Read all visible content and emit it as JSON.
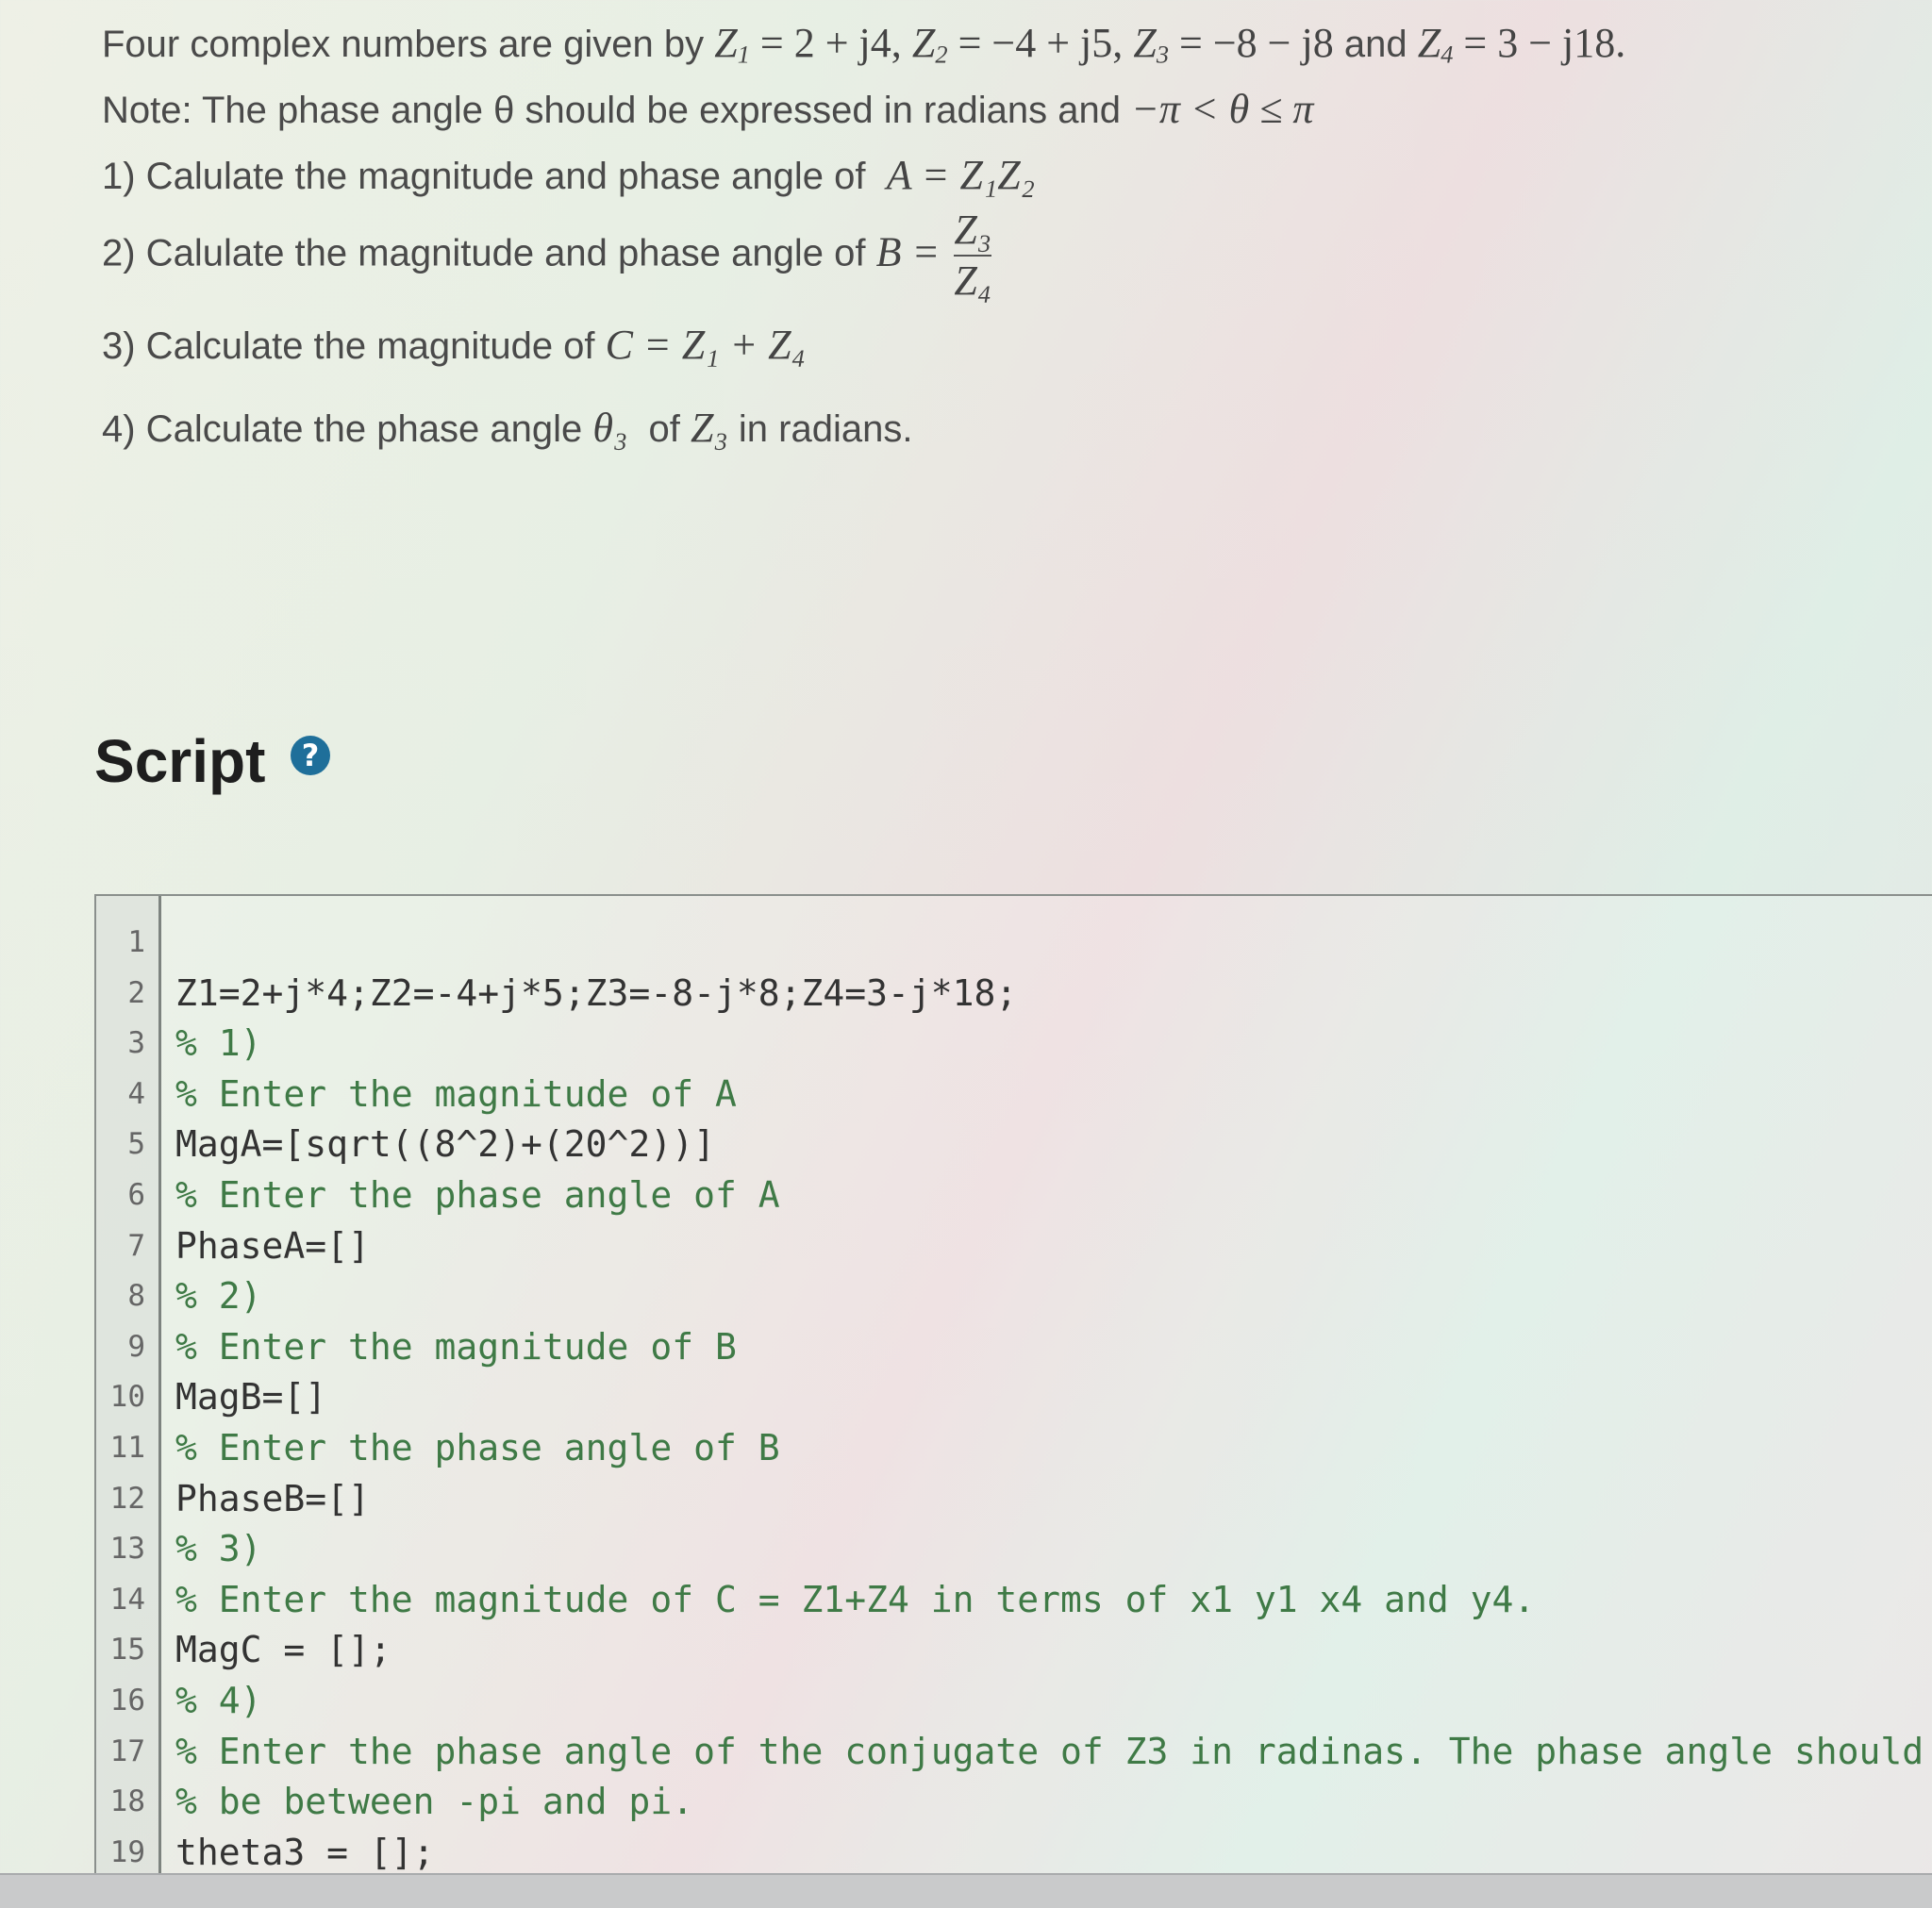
{
  "problem": {
    "intro_text": "Four complex numbers are given by",
    "z1": {
      "label": "Z",
      "sub": "1",
      "value": "= 2 + j4,"
    },
    "z2": {
      "label": "Z",
      "sub": "2",
      "value": "= −4 + j5,"
    },
    "z3": {
      "label": "Z",
      "sub": "3",
      "value": "= −8 − j8"
    },
    "and_text": "and",
    "z4": {
      "label": "Z",
      "sub": "4",
      "value": "= 3 − j18."
    },
    "note_text": "Note: The phase angle θ should be expressed in radians and",
    "note_range": "−π < θ ≤ π",
    "q1_text": "1) Calulate the magnitude and phase angle of",
    "q1_math": "A = Z₁Z₂",
    "q2_text": "2) Calulate the  magnitude and phase angle of",
    "q2_lhs": "B =",
    "q2_num": "Z₃",
    "q2_den": "Z₄",
    "q3_text": "3) Calculate the magnitude of",
    "q3_math": "C = Z₁ + Z₄",
    "q4_text_a": "4) Calculate the phase angle",
    "q4_theta": "θ₃",
    "q4_text_b": "of",
    "q4_z": "Z₃",
    "q4_text_c": "in radians."
  },
  "script_section": {
    "title": "Script",
    "help_icon": "?"
  },
  "editor": {
    "lines": [
      {
        "n": "1",
        "text": "",
        "comment": false
      },
      {
        "n": "2",
        "text": "Z1=2+j*4;Z2=-4+j*5;Z3=-8-j*8;Z4=3-j*18;",
        "comment": false
      },
      {
        "n": "3",
        "text": "% 1)",
        "comment": true
      },
      {
        "n": "4",
        "text": "% Enter the magnitude  of A",
        "comment": true
      },
      {
        "n": "5",
        "text": "MagA=[sqrt((8^2)+(20^2))]",
        "comment": false
      },
      {
        "n": "6",
        "text": "% Enter the phase angle of A",
        "comment": true
      },
      {
        "n": "7",
        "text": "PhaseA=[]",
        "comment": false
      },
      {
        "n": "8",
        "text": "% 2)",
        "comment": true
      },
      {
        "n": "9",
        "text": "% Enter the magnitude of B",
        "comment": true
      },
      {
        "n": "10",
        "text": "MagB=[]",
        "comment": false
      },
      {
        "n": "11",
        "text": "% Enter the phase angle of B",
        "comment": true
      },
      {
        "n": "12",
        "text": "PhaseB=[]",
        "comment": false
      },
      {
        "n": "13",
        "text": "% 3)",
        "comment": true
      },
      {
        "n": "14",
        "text": "% Enter the magnitude of C = Z1+Z4 in terms of x1 y1 x4 and y4.",
        "comment": true
      },
      {
        "n": "15",
        "text": "MagC = [];",
        "comment": false
      },
      {
        "n": "16",
        "text": "% 4)",
        "comment": true
      },
      {
        "n": "17",
        "text": "% Enter the phase angle of the conjugate of Z3 in radinas. The phase angle should",
        "comment": true
      },
      {
        "n": "18",
        "text": "% be between -pi and pi.",
        "comment": true
      },
      {
        "n": "19",
        "text": "theta3 = [];",
        "comment": false
      }
    ]
  },
  "colors": {
    "comment": "#3f7a46",
    "code": "#333333",
    "help_icon": "#1f6f9a"
  }
}
